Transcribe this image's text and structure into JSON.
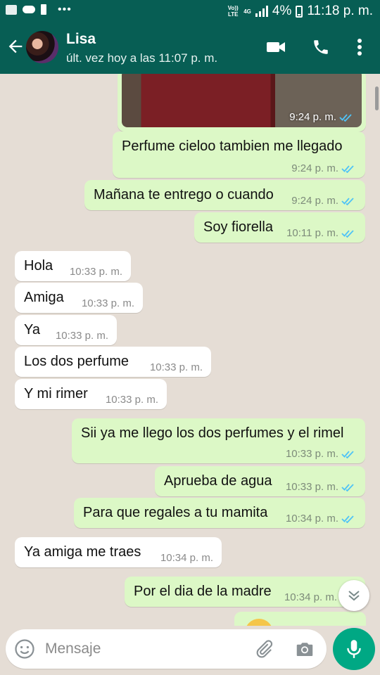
{
  "status_bar": {
    "volte": "Vo)) LTE",
    "net": "4G",
    "battery": "4%",
    "time": "11:18 p. m."
  },
  "header": {
    "contact_name": "Lisa",
    "last_seen": "últ. vez hoy a las 11:07 p. m.",
    "icons": [
      "back-arrow",
      "video-call",
      "voice-call",
      "more-vert"
    ]
  },
  "messages": [
    {
      "dir": "out",
      "type": "image",
      "time": "9:24 p. m.",
      "read": true
    },
    {
      "dir": "out",
      "text": "Perfume cieloo tambien me llegado",
      "time": "9:24 p. m.",
      "read": true
    },
    {
      "dir": "out",
      "text": "Mañana te entrego o cuando",
      "time": "9:24 p. m.",
      "read": true
    },
    {
      "dir": "out",
      "text": "Soy fiorella",
      "time": "10:11 p. m.",
      "read": true
    },
    {
      "dir": "in",
      "text": "Hola",
      "time": "10:33 p. m."
    },
    {
      "dir": "in",
      "text": "Amiga",
      "time": "10:33 p. m."
    },
    {
      "dir": "in",
      "text": "Ya",
      "time": "10:33 p. m."
    },
    {
      "dir": "in",
      "text": "Los dos perfume",
      "time": "10:33 p. m."
    },
    {
      "dir": "in",
      "text": "Y mi rimer",
      "time": "10:33 p. m."
    },
    {
      "dir": "out",
      "text": "Sii ya me llego los dos perfumes y el rimel",
      "time": "10:33 p. m.",
      "read": true
    },
    {
      "dir": "out",
      "text": "Aprueba de agua",
      "time": "10:33 p. m.",
      "read": true
    },
    {
      "dir": "out",
      "text": "Para que regales a tu mamita",
      "time": "10:34 p. m.",
      "read": true
    },
    {
      "dir": "in",
      "text": "Ya amiga me traes",
      "time": "10:34 p. m."
    },
    {
      "dir": "out",
      "text": "Por el dia de la madre",
      "time": "10:34 p. m.",
      "read": true
    }
  ],
  "composer": {
    "placeholder": "Mensaje",
    "icons": [
      "emoji",
      "attach",
      "camera",
      "mic"
    ]
  },
  "colors": {
    "header": "#075e54",
    "outgoing_bubble": "#dcf8c6",
    "incoming_bubble": "#ffffff",
    "chat_background": "#e5ddd5",
    "read_ticks": "#4fc3f7",
    "mic_button": "#00a884"
  }
}
